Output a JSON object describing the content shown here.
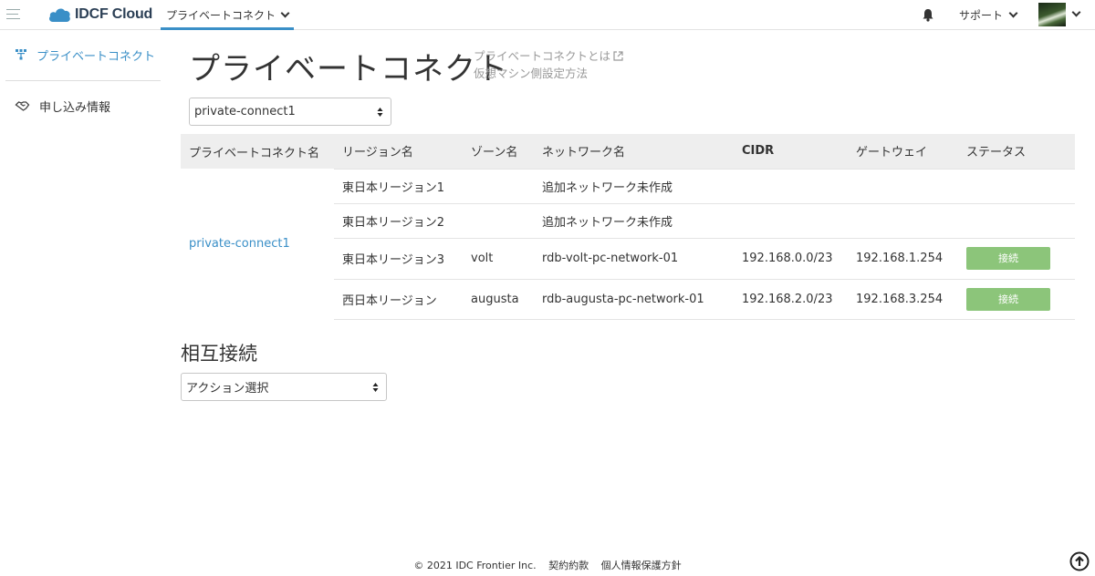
{
  "header": {
    "brand": "IDCF Cloud",
    "service_menu": "プライベートコネクト",
    "support": "サポート"
  },
  "sidebar": {
    "items": [
      {
        "label": "プライベートコネクト",
        "icon": "network-icon",
        "active": true
      },
      {
        "label": "申し込み情報",
        "icon": "handshake-icon",
        "active": false
      }
    ]
  },
  "main": {
    "title": "プライベートコネクト",
    "links": [
      "プライベートコネクトとは",
      "仮想マシン側設定方法"
    ],
    "pc_select": "private-connect1",
    "table": {
      "headers": [
        "プライベートコネクト名",
        "リージョン名",
        "ゾーン名",
        "ネットワーク名",
        "CIDR",
        "ゲートウェイ",
        "ステータス"
      ],
      "pc_name": "private-connect1",
      "rows": [
        {
          "region": "東日本リージョン1",
          "zone": "",
          "network": "追加ネットワーク未作成",
          "cidr": "",
          "gateway": "",
          "status": ""
        },
        {
          "region": "東日本リージョン2",
          "zone": "",
          "network": "追加ネットワーク未作成",
          "cidr": "",
          "gateway": "",
          "status": ""
        },
        {
          "region": "東日本リージョン3",
          "zone": "volt",
          "network": "rdb-volt-pc-network-01",
          "cidr": "192.168.0.0/23",
          "gateway": "192.168.1.254",
          "status": "接続"
        },
        {
          "region": "西日本リージョン",
          "zone": "augusta",
          "network": "rdb-augusta-pc-network-01",
          "cidr": "192.168.2.0/23",
          "gateway": "192.168.3.254",
          "status": "接続"
        }
      ]
    },
    "interconnect_title": "相互接続",
    "action_select": "アクション選択"
  },
  "footer": {
    "copyright": "© 2021 IDC Frontier Inc.",
    "terms": "契約約款",
    "privacy": "個人情報保護方針"
  },
  "colors": {
    "accent": "#3a8fc7",
    "status_green": "#8cc57a"
  }
}
